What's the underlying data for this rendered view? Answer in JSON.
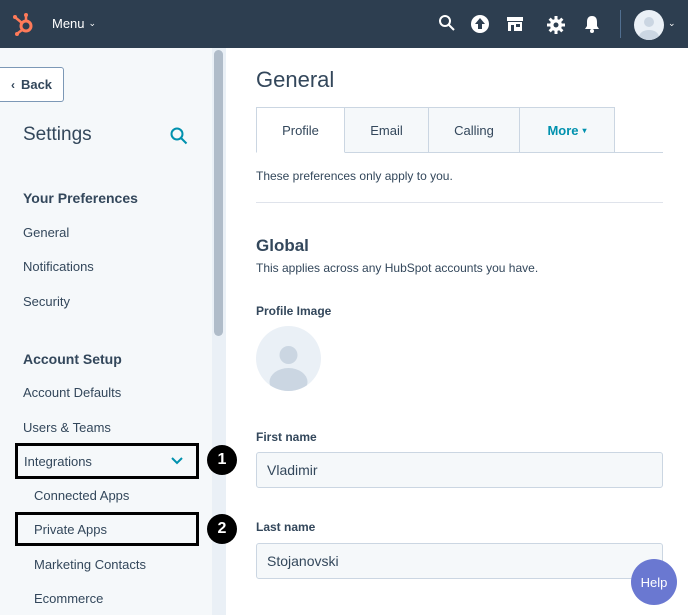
{
  "topnav": {
    "menu_label": "Menu",
    "icons": [
      "hubspot-sprocket-icon",
      "search-icon",
      "upgrade-arrow-icon",
      "marketplace-icon",
      "gear-icon",
      "bell-icon",
      "avatar"
    ],
    "brand_color": "#ff7a59",
    "bg_color": "#2d3e50"
  },
  "sidebar": {
    "back_label": "Back",
    "title": "Settings",
    "sections": [
      {
        "heading": "Your Preferences",
        "items": [
          "General",
          "Notifications",
          "Security"
        ]
      },
      {
        "heading": "Account Setup",
        "items": [
          "Account Defaults",
          "Users & Teams",
          "Integrations"
        ]
      }
    ],
    "integrations_subitems": [
      "Connected Apps",
      "Private Apps",
      "Marketing Contacts",
      "Ecommerce"
    ],
    "markers": [
      "1",
      "2"
    ]
  },
  "main": {
    "title": "General",
    "tabs": [
      "Profile",
      "Email",
      "Calling",
      "More"
    ],
    "active_tab": "Profile",
    "pref_note": "These preferences only apply to you.",
    "global_heading": "Global",
    "global_sub": "This applies across any HubSpot accounts you have.",
    "profile_image_label": "Profile Image",
    "first_name_label": "First name",
    "first_name_value": "Vladimir",
    "last_name_label": "Last name",
    "last_name_value": "Stojanovski"
  },
  "help_label": "Help",
  "accent_color": "#0091ae"
}
